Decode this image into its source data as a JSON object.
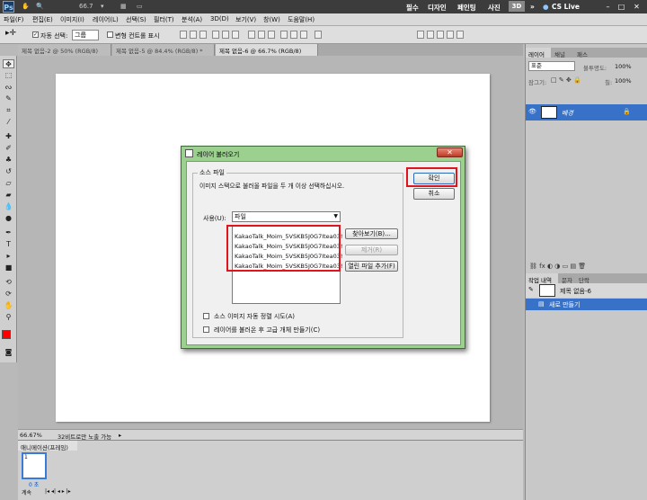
{
  "appbar": {
    "logo": "Ps",
    "zoom": "66.7",
    "workspaces": [
      "필수",
      "디자인",
      "페인팅",
      "사진"
    ],
    "three_d": "3D",
    "more": "»",
    "cslive": "CS Live",
    "win_min": "–",
    "win_max": "□",
    "win_close": "✕"
  },
  "menu": [
    "파일(F)",
    "편집(E)",
    "이미지(I)",
    "레이어(L)",
    "선택(S)",
    "필터(T)",
    "분석(A)",
    "3D(D)",
    "보기(V)",
    "창(W)",
    "도움말(H)"
  ],
  "options": {
    "auto_select": "자동 선택:",
    "auto_select_value": "그룹",
    "transform_controls": "변형 컨트롤 표시"
  },
  "tabs": [
    "제목 없음-2 @ 50% (RGB/8)",
    "제목 없음-5 @ 84.4% (RGB/8) *",
    "제목 없음-6 @ 66.7% (RGB/8)"
  ],
  "status": {
    "zoom": "66.67%",
    "info": "32비트로만 노출 가능"
  },
  "animation": {
    "tab": "애니메이션(프레임)",
    "frame_number": "1",
    "frame_delay": "0 초",
    "loop": "계속"
  },
  "right": {
    "tabs_top": [
      "레이어",
      "채널",
      "패스"
    ],
    "blend": "표준",
    "opacity_label": "불투명도:",
    "opacity": "100%",
    "lock_label": "잠그기:",
    "fill_label": "칠:",
    "fill": "100%",
    "layer_name": "배경",
    "tabs_bottom": [
      "작업 내역",
      "문자",
      "단락"
    ],
    "history_doc": "제목 없음-6",
    "history_item": "새로 만들기"
  },
  "dialog": {
    "title": "레이어 불러오기",
    "group_label": "소스 파일",
    "instruction": "이미지 스택으로 불러올 파일을 두 개 이상 선택하십시오.",
    "use_label": "사용(U):",
    "use_value": "파일",
    "files": [
      "KakaoTalk_Moim_5VSKB5J0G7Itea03!",
      "KakaoTalk_Moim_5VSKB5J0G7Itea03!",
      "KakaoTalk_Moim_5VSKB5J0G7Itea03!",
      "KakaoTalk_Moim_5VSKB5J0G7Itea03!"
    ],
    "browse": "찾아보기(B)...",
    "remove": "제거(R)",
    "add_open": "열린 파일 추가(F)",
    "ok": "확인",
    "cancel": "취소",
    "auto_align": "소스 이미지 자동 정렬 시도(A)",
    "smart_object": "레이어를 불러온 후 고급 개체 만들기(C)"
  },
  "colors": {
    "highlight": "#e0141c",
    "dialog_frame": "#9bd08f",
    "selection": "#3872c8",
    "foreground": "#ff0000"
  }
}
